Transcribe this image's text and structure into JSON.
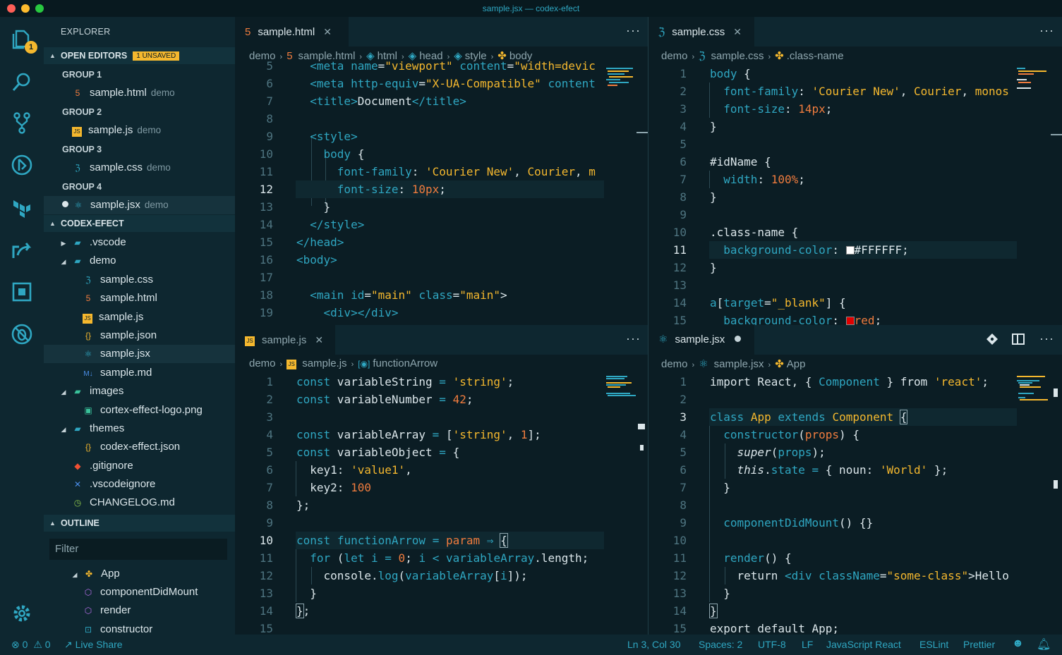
{
  "window": {
    "title": "sample.jsx — codex-efect"
  },
  "activity": {
    "badge": "1"
  },
  "sidebar": {
    "title": "EXPLORER",
    "open_editors": {
      "label": "OPEN EDITORS",
      "badge": "1 UNSAVED"
    },
    "groups": [
      {
        "label": "GROUP 1",
        "file": "sample.html",
        "folder": "demo"
      },
      {
        "label": "GROUP 2",
        "file": "sample.js",
        "folder": "demo"
      },
      {
        "label": "GROUP 3",
        "file": "sample.css",
        "folder": "demo"
      },
      {
        "label": "GROUP 4",
        "file": "sample.jsx",
        "folder": "demo"
      }
    ],
    "project": {
      "label": "CODEX-EFECT"
    },
    "tree": [
      ".vscode",
      "demo",
      "sample.css",
      "sample.html",
      "sample.js",
      "sample.json",
      "sample.jsx",
      "sample.md",
      "images",
      "cortex-effect-logo.png",
      "themes",
      "codex-effect.json",
      ".gitignore",
      ".vscodeignore",
      "CHANGELOG.md"
    ],
    "outline": {
      "label": "OUTLINE",
      "filter_placeholder": "Filter",
      "items": [
        "App",
        "componentDidMount",
        "render",
        "constructor"
      ]
    }
  },
  "editors": {
    "html": {
      "tab": "sample.html",
      "crumbs": [
        "demo",
        "sample.html",
        "html",
        "head",
        "style",
        "body"
      ],
      "lines": [
        "5",
        "6",
        "7",
        "8",
        "9",
        "10",
        "11",
        "12",
        "13",
        "14",
        "15",
        "16",
        "17",
        "18",
        "19"
      ]
    },
    "css": {
      "tab": "sample.css",
      "crumbs": [
        "demo",
        "sample.css",
        ".class-name"
      ],
      "lines": [
        "1",
        "2",
        "3",
        "4",
        "5",
        "6",
        "7",
        "8",
        "9",
        "10",
        "11",
        "12",
        "13",
        "14",
        "15"
      ]
    },
    "js": {
      "tab": "sample.js",
      "crumbs": [
        "demo",
        "sample.js",
        "functionArrow"
      ],
      "lines": [
        "1",
        "2",
        "3",
        "4",
        "5",
        "6",
        "7",
        "8",
        "9",
        "10",
        "11",
        "12",
        "13",
        "14",
        "15"
      ]
    },
    "jsx": {
      "tab": "sample.jsx",
      "crumbs": [
        "demo",
        "sample.jsx",
        "App"
      ],
      "lines": [
        "1",
        "2",
        "3",
        "4",
        "5",
        "6",
        "7",
        "8",
        "9",
        "10",
        "11",
        "12",
        "13",
        "14",
        "15"
      ]
    }
  },
  "statusbar": {
    "errors": "0",
    "warnings": "0",
    "live_share": "Live Share",
    "position": "Ln 3, Col 30",
    "spaces": "Spaces: 2",
    "encoding": "UTF-8",
    "eol": "LF",
    "language": "JavaScript React",
    "eslint": "ESLint",
    "prettier": "Prettier"
  },
  "colors": {
    "accent": "#2fa7c2",
    "string": "#f5b82e",
    "number": "#f07c3e",
    "background": "#0b1d24"
  }
}
